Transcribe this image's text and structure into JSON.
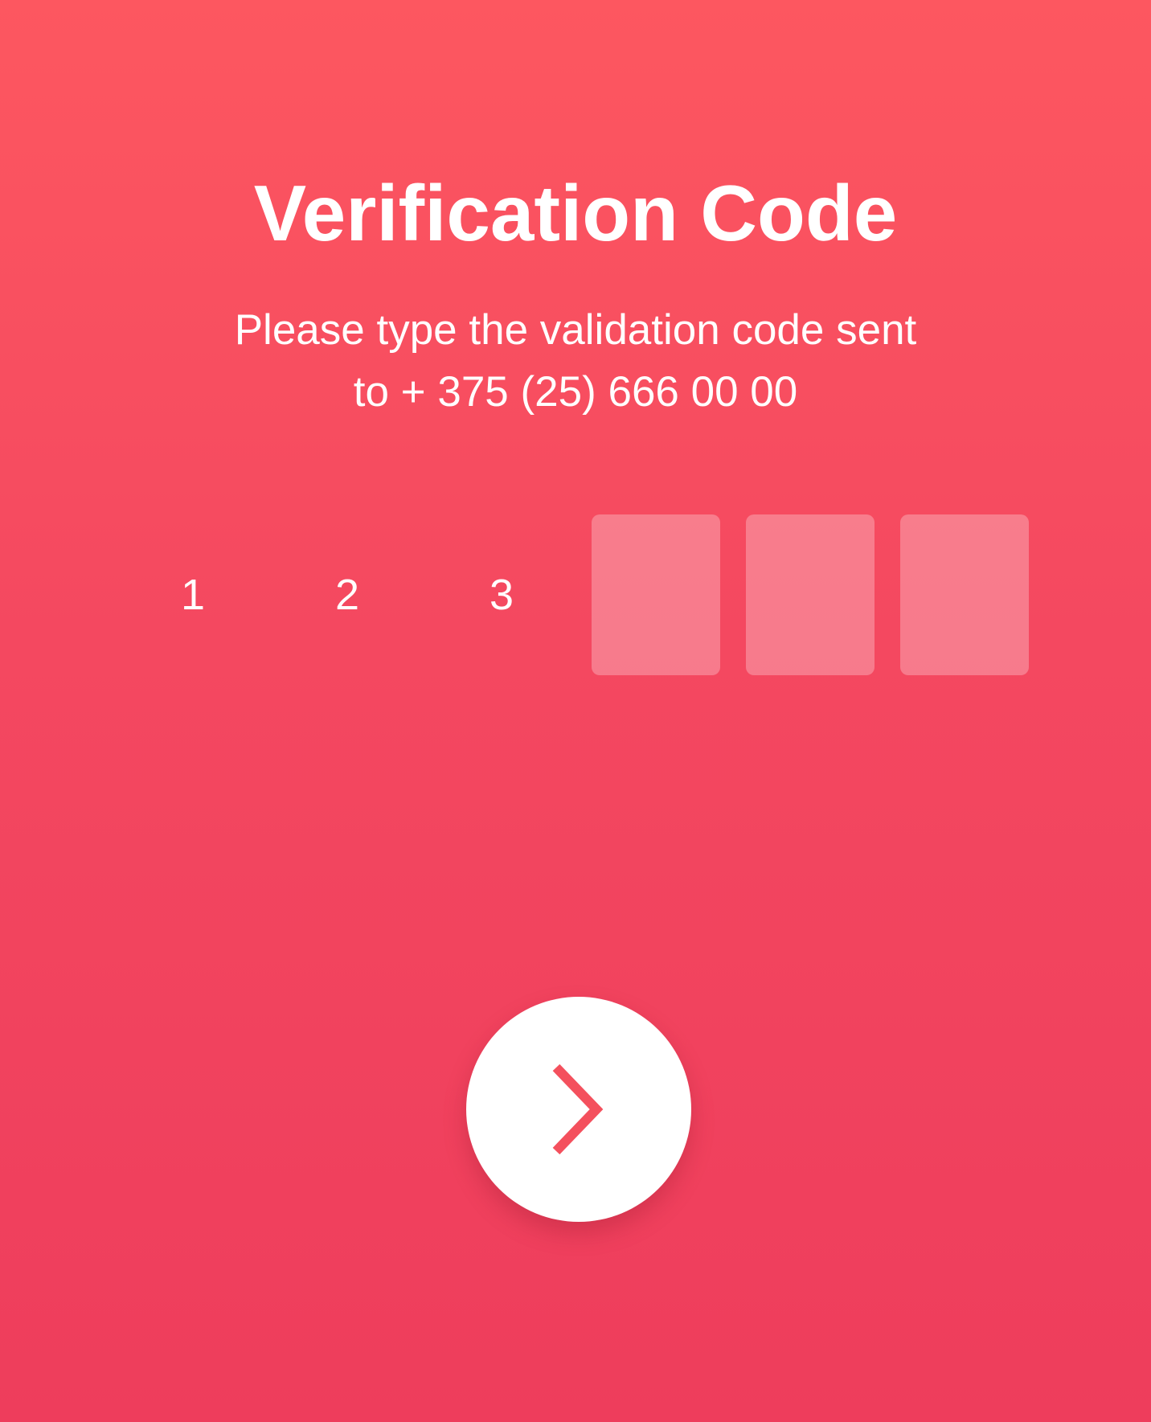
{
  "header": {
    "title": "Verification Code",
    "subtitle_line1": "Please type the validation code sent",
    "subtitle_line2": "to + 375 (25) 666 00 00"
  },
  "code": {
    "digits": [
      "1",
      "2",
      "3",
      "",
      "",
      ""
    ]
  },
  "actions": {
    "next_icon": "chevron-right-icon"
  },
  "colors": {
    "background_top": "#fd5760",
    "background_bottom": "#ee3d5c",
    "accent": "#f4505d",
    "text": "#ffffff"
  }
}
